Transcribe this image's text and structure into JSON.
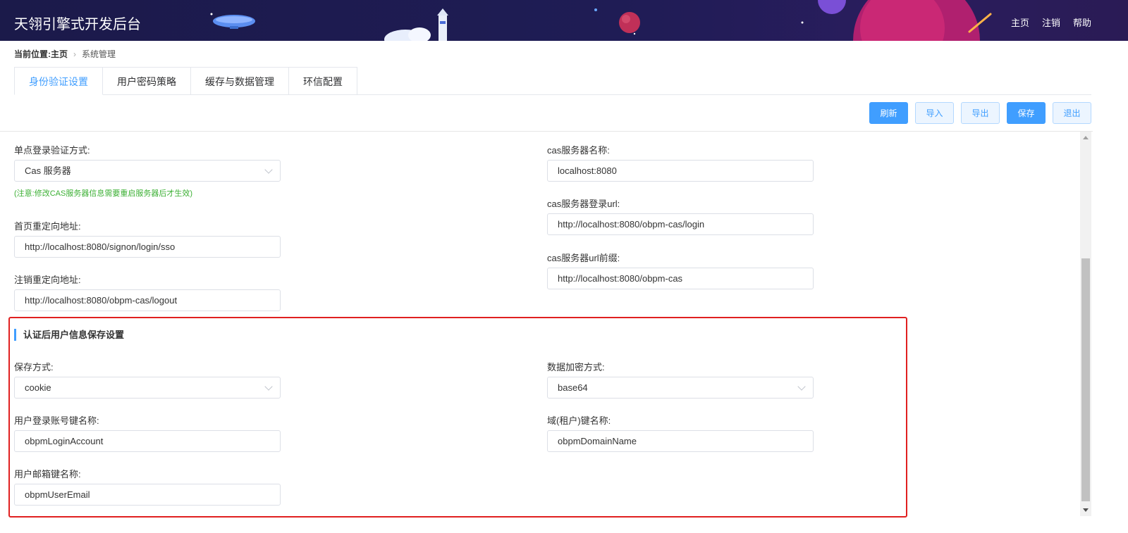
{
  "header": {
    "title": "天翎引擎式开发后台",
    "nav": [
      "主页",
      "注销",
      "帮助"
    ]
  },
  "breadcrumb": {
    "prefix": "当前位置:",
    "home": "主页",
    "current": "系统管理"
  },
  "tabs": [
    {
      "label": "身份验证设置",
      "active": true
    },
    {
      "label": "用户密码策略",
      "active": false
    },
    {
      "label": "缓存与数据管理",
      "active": false
    },
    {
      "label": "环信配置",
      "active": false
    }
  ],
  "toolbar": {
    "refresh": "刷新",
    "import": "导入",
    "export": "导出",
    "save": "保存",
    "exit": "退出"
  },
  "form": {
    "sso_method": {
      "label": "单点登录验证方式:",
      "value": "Cas 服务器"
    },
    "note": "(注意:修改CAS服务器信息需要重启服务器后才生效)",
    "home_redirect": {
      "label": "首页重定向地址:",
      "value": "http://localhost:8080/signon/login/sso"
    },
    "logout_redirect": {
      "label": "注销重定向地址:",
      "value": "http://localhost:8080/obpm-cas/logout"
    },
    "cas_server_name": {
      "label": "cas服务器名称:",
      "value": "localhost:8080"
    },
    "cas_login_url": {
      "label": "cas服务器登录url:",
      "value": "http://localhost:8080/obpm-cas/login"
    },
    "cas_url_prefix": {
      "label": "cas服务器url前缀:",
      "value": "http://localhost:8080/obpm-cas"
    }
  },
  "section": {
    "title": "认证后用户信息保存设置",
    "save_method": {
      "label": "保存方式:",
      "value": "cookie"
    },
    "encrypt_method": {
      "label": "数据加密方式:",
      "value": "base64"
    },
    "login_account_key": {
      "label": "用户登录账号键名称:",
      "value": "obpmLoginAccount"
    },
    "domain_key": {
      "label": "域(租户)键名称:",
      "value": "obpmDomainName"
    },
    "email_key": {
      "label": "用户邮箱键名称:",
      "value": "obpmUserEmail"
    }
  },
  "colors": {
    "accent": "#409eff",
    "note": "#3cb034",
    "highlight": "#e02020",
    "header_bg": "#1f1c55"
  }
}
